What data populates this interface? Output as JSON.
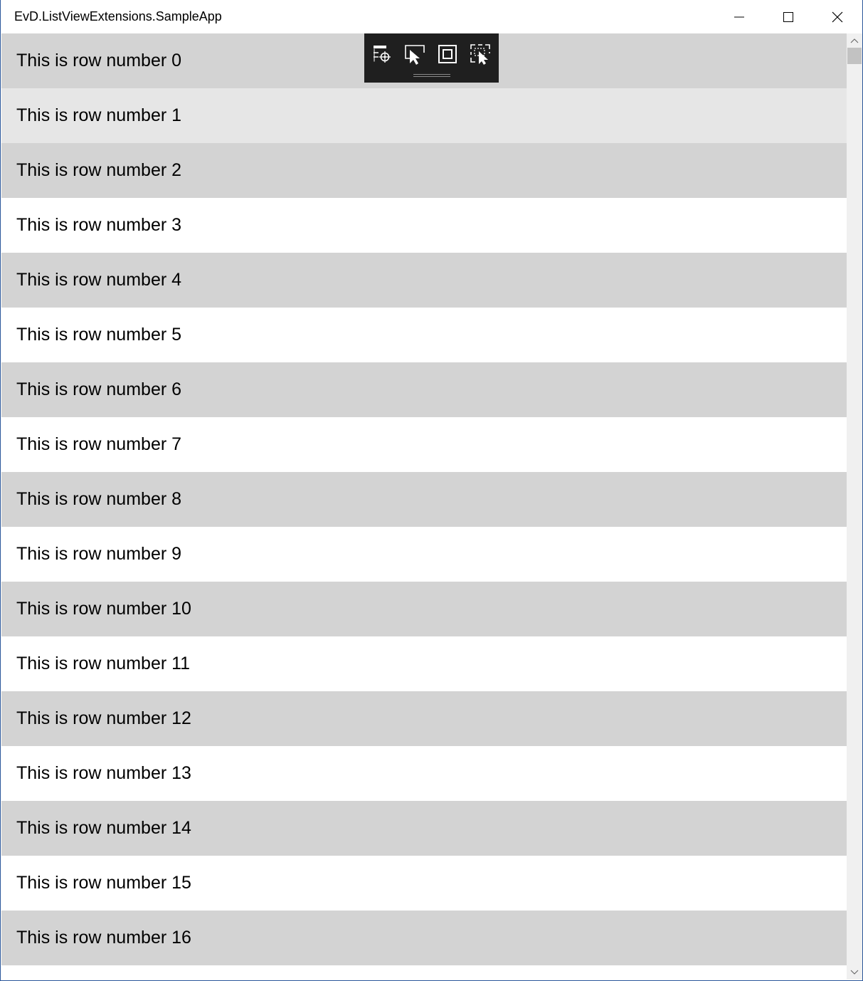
{
  "window": {
    "title": "EvD.ListViewExtensions.SampleApp",
    "controls": {
      "minimize_icon": "minimize-icon",
      "maximize_icon": "maximize-icon",
      "close_icon": "close-icon"
    }
  },
  "debug_toolbar": {
    "tools": [
      {
        "name": "visual-tree-icon"
      },
      {
        "name": "select-element-icon"
      },
      {
        "name": "display-adorners-icon"
      },
      {
        "name": "track-focus-icon"
      }
    ]
  },
  "list": {
    "rows": [
      {
        "label": "This is row number 0",
        "style": "even"
      },
      {
        "label": "This is row number 1",
        "style": "hover"
      },
      {
        "label": "This is row number 2",
        "style": "even"
      },
      {
        "label": "This is row number 3",
        "style": "odd"
      },
      {
        "label": "This is row number 4",
        "style": "even"
      },
      {
        "label": "This is row number 5",
        "style": "odd"
      },
      {
        "label": "This is row number 6",
        "style": "even"
      },
      {
        "label": "This is row number 7",
        "style": "odd"
      },
      {
        "label": "This is row number 8",
        "style": "even"
      },
      {
        "label": "This is row number 9",
        "style": "odd"
      },
      {
        "label": "This is row number 10",
        "style": "even"
      },
      {
        "label": "This is row number 11",
        "style": "odd"
      },
      {
        "label": "This is row number 12",
        "style": "even"
      },
      {
        "label": "This is row number 13",
        "style": "odd"
      },
      {
        "label": "This is row number 14",
        "style": "even"
      },
      {
        "label": "This is row number 15",
        "style": "odd"
      },
      {
        "label": "This is row number 16",
        "style": "even"
      },
      {
        "label": "",
        "style": "odd"
      }
    ]
  },
  "colors": {
    "row_alt": "#d3d3d3",
    "row_plain": "#ffffff",
    "row_hover": "#e6e6e6",
    "window_border": "#2b579a",
    "toolbar_bg": "#1f1f1f"
  }
}
